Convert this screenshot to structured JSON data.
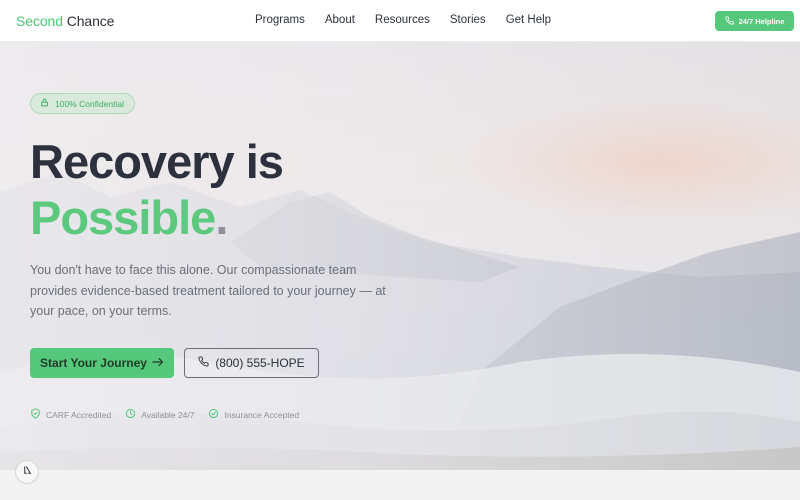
{
  "brand": {
    "part1": "Second",
    "part2": "Chance"
  },
  "nav": {
    "items": [
      {
        "label": "Programs"
      },
      {
        "label": "About"
      },
      {
        "label": "Resources"
      },
      {
        "label": "Stories"
      },
      {
        "label": "Get Help"
      }
    ],
    "helpline_label": "24/7 Helpline"
  },
  "hero": {
    "badge": "100% Confidential",
    "headline_line1": "Recovery is",
    "headline_line2": "Possible",
    "headline_dot": ".",
    "description": "You don't have to face this alone. Our compassionate team provides evidence-based treatment tailored to your journey — at your pace, on your terms.",
    "primary_button": "Start Your Journey",
    "phone_button": "(800) 555-HOPE",
    "features": [
      {
        "icon": "shield-check-icon",
        "label": "CARF Accredited"
      },
      {
        "icon": "clock-icon",
        "label": "Available 24/7"
      },
      {
        "icon": "check-circle-icon",
        "label": "Insurance Accepted"
      }
    ]
  },
  "colors": {
    "accent": "#55c87b",
    "accent_text": "#5dc97f",
    "heading": "#2c313d",
    "body_text": "#6a6f78",
    "muted": "#8d9199"
  },
  "icons": {
    "helpline": "phone-icon",
    "badge": "lock-icon",
    "primary_button": "arrow-right-icon",
    "phone_button": "phone-icon",
    "widget": "accessibility-widget-icon"
  }
}
